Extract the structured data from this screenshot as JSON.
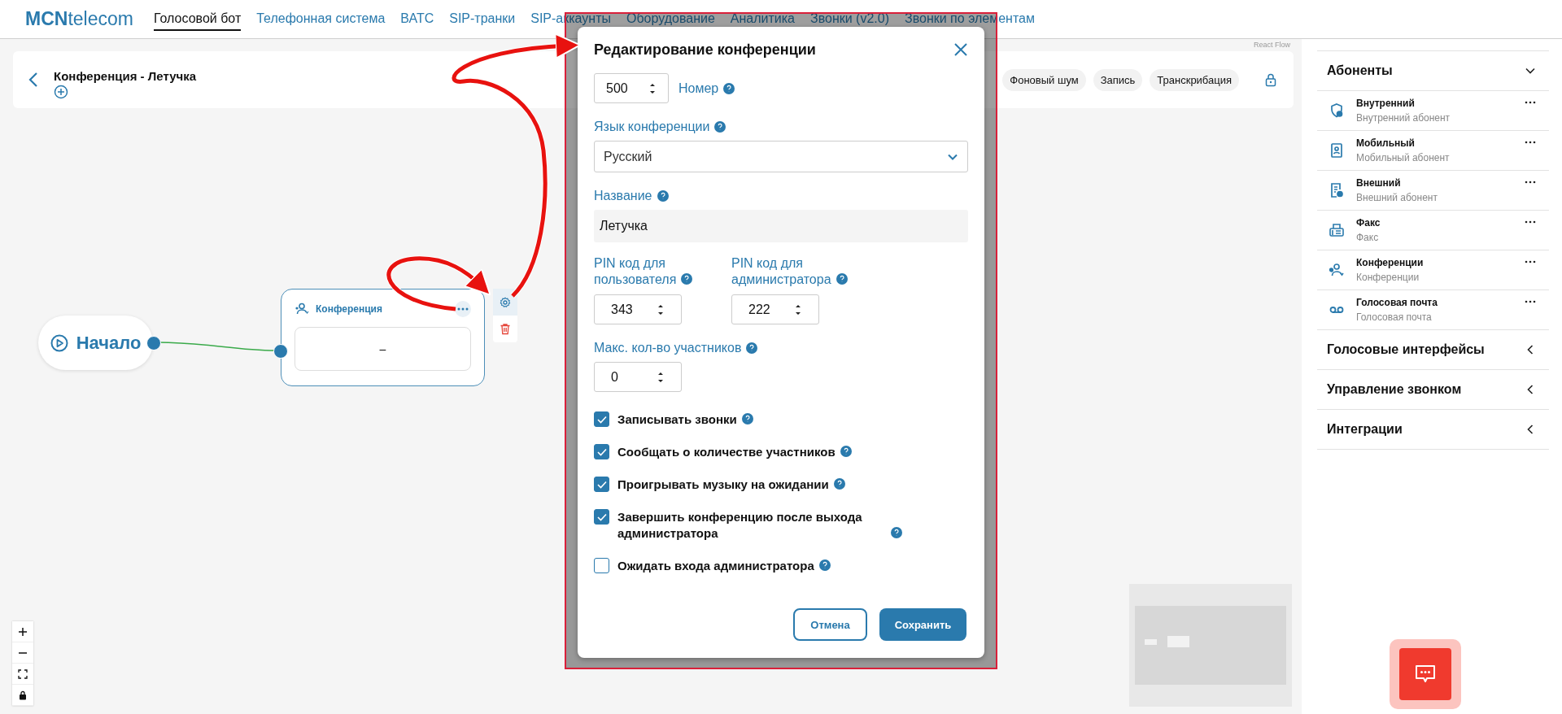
{
  "nav": {
    "logo": "**MCN**telecom",
    "items": [
      {
        "label": "Голосовой бот",
        "selected": true
      },
      {
        "label": "Телефонная система",
        "selected": false
      },
      {
        "label": "ВАТС",
        "selected": false
      },
      {
        "label": "SIP-транки",
        "selected": false
      },
      {
        "label": "SIP-аккаунты",
        "selected": false
      },
      {
        "label": "Оборудование",
        "selected": false
      },
      {
        "label": "Аналитика",
        "selected": false
      },
      {
        "label": "Звонки (v2.0)",
        "selected": false
      },
      {
        "label": "Звонки по элементам",
        "selected": false
      }
    ]
  },
  "flow_header": {
    "title": "Конференция - Летучка",
    "chips": [
      "Фоновый шум",
      "Запись",
      "Транскрибация"
    ]
  },
  "canvas": {
    "watermark": "React Flow",
    "start_node": {
      "label": "Начало"
    },
    "conference_node": {
      "title": "Конференция",
      "value": "–"
    }
  },
  "sidebar": {
    "sections": [
      {
        "title": "Абоненты",
        "expanded": true,
        "items": [
          {
            "title": "Внутренний",
            "subtitle": "Внутренний абонент"
          },
          {
            "title": "Мобильный",
            "subtitle": "Мобильный абонент"
          },
          {
            "title": "Внешний",
            "subtitle": "Внешний абонент"
          },
          {
            "title": "Факс",
            "subtitle": "Факс"
          },
          {
            "title": "Конференции",
            "subtitle": "Конференции"
          },
          {
            "title": "Голосовая почта",
            "subtitle": "Голосовая почта"
          }
        ]
      },
      {
        "title": "Голосовые интерфейсы",
        "expanded": false
      },
      {
        "title": "Управление звонком",
        "expanded": false
      },
      {
        "title": "Интеграции",
        "expanded": false
      }
    ]
  },
  "dialog": {
    "title": "Редактирование конференции",
    "number": {
      "value": "500",
      "label": "Номер"
    },
    "language": {
      "label": "Язык конференции",
      "value": "Русский"
    },
    "name": {
      "label": "Название",
      "value": "Летучка"
    },
    "pins": [
      {
        "label": "PIN код для пользователя",
        "value": "343"
      },
      {
        "label": "PIN код для администратора",
        "value": "222"
      }
    ],
    "max_participants": {
      "label": "Макс. кол-во участников",
      "value": "0"
    },
    "options": [
      {
        "label": "Записывать звонки",
        "checked": true
      },
      {
        "label": "Сообщать о количестве участников",
        "checked": true
      },
      {
        "label": "Проигрывать музыку на ожидании",
        "checked": true
      },
      {
        "label": "Завершить конференцию после выхода администратора",
        "checked": true
      },
      {
        "label": "Ожидать входа администратора",
        "checked": false
      }
    ],
    "buttons": {
      "cancel": "Отмена",
      "save": "Сохранить"
    }
  }
}
